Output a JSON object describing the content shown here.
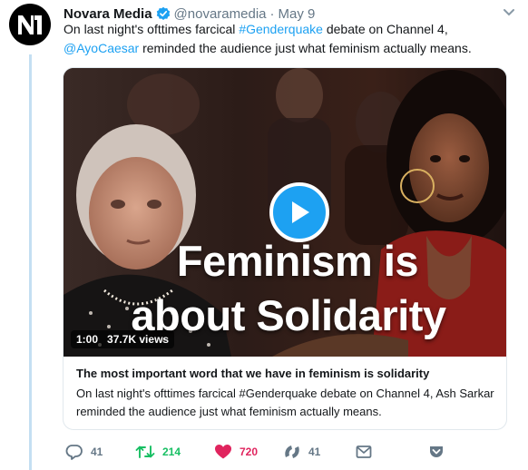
{
  "tweet": {
    "author_name": "Novara Media",
    "handle": "@novaramedia",
    "separator": "·",
    "date": "May 9",
    "text_part1": "On last night's ofttimes farcical ",
    "hashtag": "#Genderquake",
    "text_part2": " debate on Channel 4,",
    "mention": "@AyoCaesar",
    "text_part3": " reminded the audience just what feminism actually means."
  },
  "media": {
    "overlay_line1": "Feminism is",
    "overlay_line2": "about Solidarity",
    "duration": "1:00",
    "views": "37.7K views"
  },
  "card": {
    "title": "The most important word that we have in feminism is solidarity",
    "description": "On last night's ofttimes farcical #Genderquake debate on Channel 4, Ash Sarkar reminded the audience just what feminism actually means."
  },
  "actions": {
    "reply_count": "41",
    "retweet_count": "214",
    "like_count": "720",
    "moment_count": "41"
  },
  "colors": {
    "link": "#1da1f2",
    "retweet": "#17bf63",
    "like": "#e0245e",
    "muted": "#657786",
    "thread_line": "#c4dff2"
  }
}
